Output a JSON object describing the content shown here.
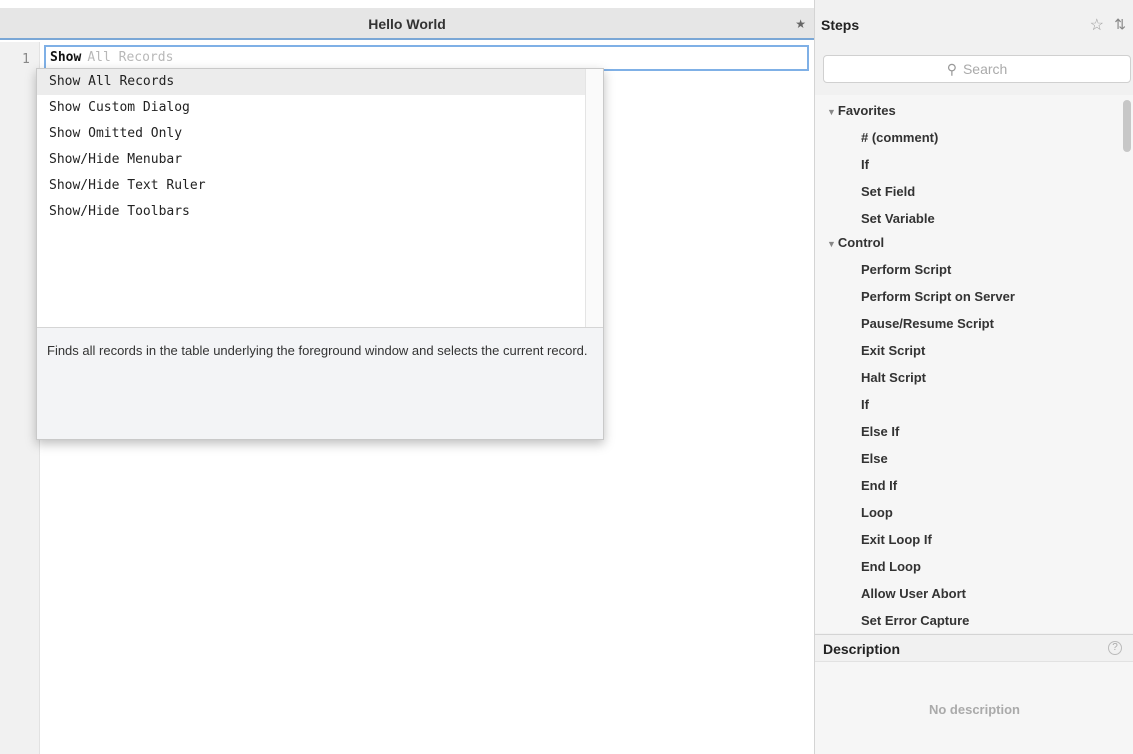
{
  "editor": {
    "title": "Hello World",
    "line_number": "1",
    "typed_text": "Show",
    "ghost_text": "All Records"
  },
  "autocomplete": {
    "items": [
      "Show All Records",
      "Show Custom Dialog",
      "Show Omitted Only",
      "Show/Hide Menubar",
      "Show/Hide Text Ruler",
      "Show/Hide Toolbars"
    ],
    "selected_index": 0,
    "description": "Finds all records in the table underlying the foreground window and selects the current record."
  },
  "steps_panel": {
    "title": "Steps",
    "search_placeholder": "Search",
    "categories": [
      {
        "name": "Favorites",
        "items": [
          "# (comment)",
          "If",
          "Set Field",
          "Set Variable"
        ]
      },
      {
        "name": "Control",
        "items": [
          "Perform Script",
          "Perform Script on Server",
          "Pause/Resume Script",
          "Exit Script",
          "Halt Script",
          "If",
          "Else If",
          "Else",
          "End If",
          "Loop",
          "Exit Loop If",
          "End Loop",
          "Allow User Abort",
          "Set Error Capture"
        ]
      }
    ],
    "description_title": "Description",
    "no_description": "No description"
  },
  "icons": {
    "tab_star": "star-icon",
    "favorites": "star-outline-icon",
    "sort": "sort-icon",
    "search": "magnifier-icon",
    "help": "help-icon"
  },
  "colors": {
    "focus_blue": "#7fb0e6",
    "panel_bg": "#f1f1f1",
    "selected_row": "#ececec"
  }
}
